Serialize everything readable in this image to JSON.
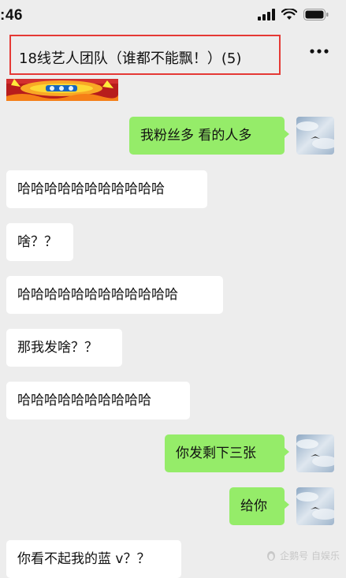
{
  "status_bar": {
    "time": ":46"
  },
  "header": {
    "title": "18线艺人团队（谁都不能飘！）(5)"
  },
  "messages": [
    {
      "side": "right",
      "text": "我粉丝多 看的人多"
    },
    {
      "side": "left",
      "text": "哈哈哈哈哈哈哈哈哈哈哈"
    },
    {
      "side": "left",
      "text": "啥？？"
    },
    {
      "side": "left",
      "text": "哈哈哈哈哈哈哈哈哈哈哈哈"
    },
    {
      "side": "left",
      "text": "那我发啥？？"
    },
    {
      "side": "left",
      "text": "哈哈哈哈哈哈哈哈哈哈"
    },
    {
      "side": "right",
      "text": "你发剩下三张"
    },
    {
      "side": "right",
      "text": "给你"
    },
    {
      "side": "left",
      "text": "你看不起我的蓝 v？？"
    }
  ],
  "watermark": {
    "text": "企鹅号 自娱乐"
  },
  "colors": {
    "background": "#ededed",
    "self_bubble": "#95ec69",
    "other_bubble": "#ffffff",
    "highlight_box": "#e53935"
  }
}
